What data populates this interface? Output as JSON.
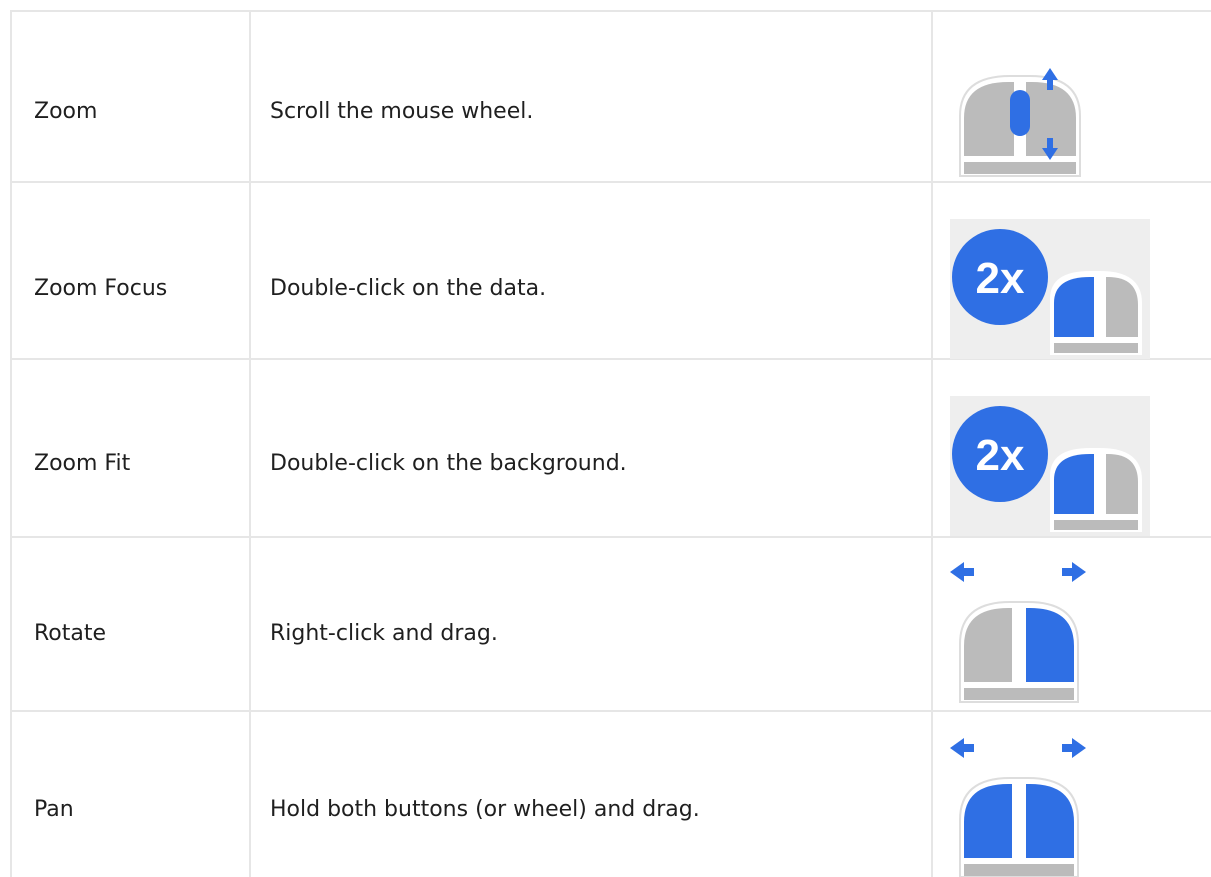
{
  "rows": [
    {
      "action": "Zoom",
      "description": "Scroll the mouse wheel.",
      "icon": "mouse-wheel-scroll-icon"
    },
    {
      "action": "Zoom Focus",
      "description": "Double-click on the data.",
      "icon": "double-click-mouse-icon"
    },
    {
      "action": "Zoom Fit",
      "description": "Double-click on the background.",
      "icon": "double-click-mouse-icon"
    },
    {
      "action": "Rotate",
      "description": "Right-click and drag.",
      "icon": "right-drag-mouse-icon"
    },
    {
      "action": "Pan",
      "description": "Hold both buttons (or wheel) and drag.",
      "icon": "both-buttons-drag-mouse-icon"
    }
  ],
  "badge_text": "2x",
  "colors": {
    "accent": "#2F6FE4",
    "mouse_gray": "#BBBBBB",
    "grid": "#E6E6E6",
    "icon_bg": "#EEEEEE"
  }
}
